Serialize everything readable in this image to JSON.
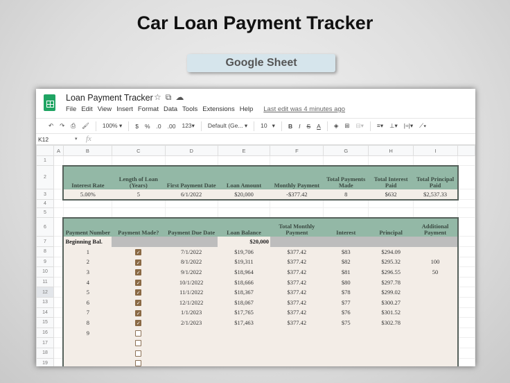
{
  "page": {
    "title": "Car Loan Payment Tracker",
    "badge": "Google Sheet"
  },
  "app": {
    "doc_name": "Loan Payment Tracker",
    "doc_icons": [
      "star-icon",
      "move-to-folder-icon",
      "cloud-status-icon"
    ],
    "menu": [
      "File",
      "Edit",
      "View",
      "Insert",
      "Format",
      "Data",
      "Tools",
      "Extensions",
      "Help"
    ],
    "last_edit": "Last edit was 4 minutes ago",
    "toolbar": {
      "zoom": "100%",
      "currency": "$",
      "percent": "%",
      "dec_decrease": ".0",
      "dec_increase": ".00",
      "more_formats": "123▾",
      "font": "Default (Ge...",
      "font_size": "10"
    },
    "cell_ref": "K12",
    "fx": "fx",
    "brand_green": "#1fa463"
  },
  "sheet": {
    "columns": [
      "",
      "A",
      "B",
      "C",
      "D",
      "E",
      "F",
      "G",
      "H",
      "I",
      ""
    ],
    "selected_row": 12,
    "header_color": "#93b8a6",
    "body_color": "#f3ede7",
    "summary": {
      "headers": [
        "Interest Rate",
        "Length of Loan (Years)",
        "First Payment Date",
        "Loan Amount",
        "Monthly Payment",
        "Total Payments Made",
        "Total Interest Paid",
        "Total Principal Paid"
      ],
      "values": [
        "5.00%",
        "5",
        "6/1/2022",
        "$20,000",
        "-$377.42",
        "8",
        "$632",
        "$2,537.33"
      ]
    },
    "payments": {
      "headers": [
        "Payment Number",
        "Payment Made?",
        "Payment Due Date",
        "Loan Balance",
        "Total Monthly Payment",
        "Interest",
        "Principal",
        "Additional Payment"
      ],
      "beginning_label": "Beginning Bal.",
      "beginning_balance": "$20,000",
      "rows": [
        {
          "num": "1",
          "paid": true,
          "due": "7/1/2022",
          "balance": "$19,706",
          "total": "$377.42",
          "interest": "$83",
          "principal": "$294.09",
          "additional": ""
        },
        {
          "num": "2",
          "paid": true,
          "due": "8/1/2022",
          "balance": "$19,311",
          "total": "$377.42",
          "interest": "$82",
          "principal": "$295.32",
          "additional": "100"
        },
        {
          "num": "3",
          "paid": true,
          "due": "9/1/2022",
          "balance": "$18,964",
          "total": "$377.42",
          "interest": "$81",
          "principal": "$296.55",
          "additional": "50"
        },
        {
          "num": "4",
          "paid": true,
          "due": "10/1/2022",
          "balance": "$18,666",
          "total": "$377.42",
          "interest": "$80",
          "principal": "$297.78",
          "additional": ""
        },
        {
          "num": "5",
          "paid": true,
          "due": "11/1/2022",
          "balance": "$18,367",
          "total": "$377.42",
          "interest": "$78",
          "principal": "$299.02",
          "additional": ""
        },
        {
          "num": "6",
          "paid": true,
          "due": "12/1/2022",
          "balance": "$18,067",
          "total": "$377.42",
          "interest": "$77",
          "principal": "$300.27",
          "additional": ""
        },
        {
          "num": "7",
          "paid": true,
          "due": "1/1/2023",
          "balance": "$17,765",
          "total": "$377.42",
          "interest": "$76",
          "principal": "$301.52",
          "additional": ""
        },
        {
          "num": "8",
          "paid": true,
          "due": "2/1/2023",
          "balance": "$17,463",
          "total": "$377.42",
          "interest": "$75",
          "principal": "$302.78",
          "additional": ""
        },
        {
          "num": "9",
          "paid": false,
          "due": "",
          "balance": "",
          "total": "",
          "interest": "",
          "principal": "",
          "additional": ""
        },
        {
          "num": "",
          "paid": false,
          "due": "",
          "balance": "",
          "total": "",
          "interest": "",
          "principal": "",
          "additional": ""
        },
        {
          "num": "",
          "paid": false,
          "due": "",
          "balance": "",
          "total": "",
          "interest": "",
          "principal": "",
          "additional": ""
        },
        {
          "num": "",
          "paid": false,
          "due": "",
          "balance": "",
          "total": "",
          "interest": "",
          "principal": "",
          "additional": ""
        }
      ]
    }
  }
}
